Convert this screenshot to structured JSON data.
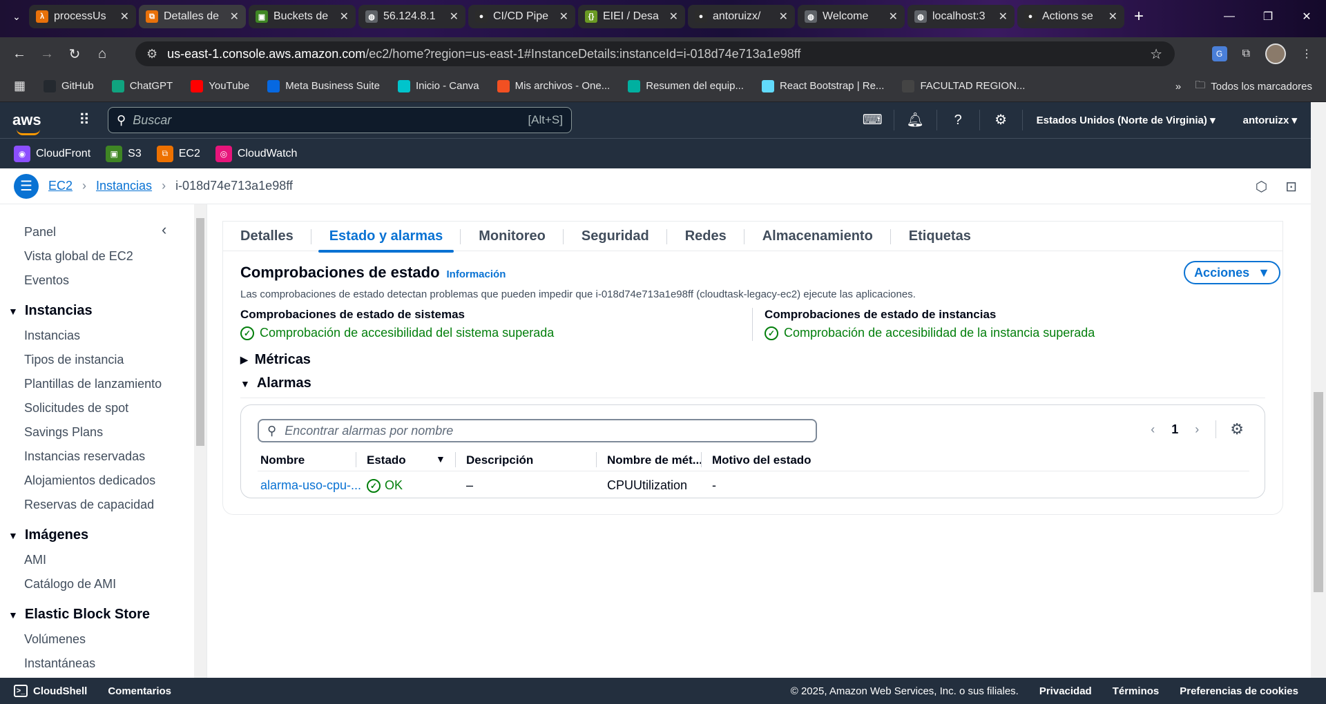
{
  "browser": {
    "tabs": [
      {
        "label": "processUs",
        "color": "#e8710a",
        "glyph": "λ"
      },
      {
        "label": "Detalles de",
        "color": "#e8710a",
        "glyph": "⧉"
      },
      {
        "label": "Buckets de",
        "color": "#3f8624",
        "glyph": "▣"
      },
      {
        "label": "56.124.8.1",
        "color": "#5f6368",
        "glyph": "◍"
      },
      {
        "label": "CI/CD Pipe",
        "color": "#2b2b2b",
        "glyph": "●"
      },
      {
        "label": "EIEI / Desa",
        "color": "#6a9a23",
        "glyph": "{}"
      },
      {
        "label": "antoruizx/",
        "color": "#2b2b2b",
        "glyph": "●"
      },
      {
        "label": "Welcome",
        "color": "#5f6368",
        "glyph": "◍"
      },
      {
        "label": "localhost:3",
        "color": "#5f6368",
        "glyph": "◍"
      },
      {
        "label": "Actions se",
        "color": "#2b2b2b",
        "glyph": "●"
      }
    ],
    "url_host": "us-east-1.console.aws.amazon.com",
    "url_path": "/ec2/home?region=us-east-1#InstanceDetails:instanceId=i-018d74e713a1e98ff",
    "bookmarks": [
      {
        "label": "GitHub",
        "color": "#24292f"
      },
      {
        "label": "ChatGPT",
        "color": "#10a37f"
      },
      {
        "label": "YouTube",
        "color": "#ff0000"
      },
      {
        "label": "Meta Business Suite",
        "color": "#0668e1"
      },
      {
        "label": "Inicio - Canva",
        "color": "#00c4cc"
      },
      {
        "label": "Mis archivos - One...",
        "color": "#f25022"
      },
      {
        "label": "Resumen del equip...",
        "color": "#00b0a0"
      },
      {
        "label": "React Bootstrap | Re...",
        "color": "#61dafb"
      },
      {
        "label": "FACULTAD REGION...",
        "color": "#444444"
      }
    ],
    "all_bookmarks": "Todos los marcadores"
  },
  "aws": {
    "logo": "aws",
    "search_placeholder": "Buscar",
    "search_shortcut": "[Alt+S]",
    "region": "Estados Unidos (Norte de Virginia)",
    "user": "antoruizx",
    "services": [
      {
        "label": "CloudFront",
        "color": "#8c4fff"
      },
      {
        "label": "S3",
        "color": "#3f8624"
      },
      {
        "label": "EC2",
        "color": "#ed7100"
      },
      {
        "label": "CloudWatch",
        "color": "#e7157b"
      }
    ]
  },
  "breadcrumb": {
    "ec2": "EC2",
    "instancias": "Instancias",
    "current": "i-018d74e713a1e98ff"
  },
  "sidebar": {
    "top_items": [
      "Panel",
      "Vista global de EC2",
      "Eventos"
    ],
    "sections": [
      {
        "title": "Instancias",
        "items": [
          "Instancias",
          "Tipos de instancia",
          "Plantillas de lanzamiento",
          "Solicitudes de spot",
          "Savings Plans",
          "Instancias reservadas",
          "Alojamientos dedicados",
          "Reservas de capacidad"
        ]
      },
      {
        "title": "Imágenes",
        "items": [
          "AMI",
          "Catálogo de AMI"
        ]
      },
      {
        "title": "Elastic Block Store",
        "items": [
          "Volúmenes",
          "Instantáneas"
        ]
      }
    ]
  },
  "tabs": [
    "Detalles",
    "Estado y alarmas",
    "Monitoreo",
    "Seguridad",
    "Redes",
    "Almacenamiento",
    "Etiquetas"
  ],
  "active_tab": "Estado y alarmas",
  "status_checks": {
    "title": "Comprobaciones de estado",
    "info": "Información",
    "actions": "Acciones",
    "description": "Las comprobaciones de estado detectan problemas que pueden impedir que i-018d74e713a1e98ff (cloudtask-legacy-ec2) ejecute las aplicaciones.",
    "system_title": "Comprobaciones de estado de sistemas",
    "system_result": "Comprobación de accesibilidad del sistema superada",
    "instance_title": "Comprobaciones de estado de instancias",
    "instance_result": "Comprobación de accesibilidad de la instancia superada"
  },
  "metrics_label": "Métricas",
  "alarms": {
    "label": "Alarmas",
    "search_placeholder": "Encontrar alarmas por nombre",
    "page": "1",
    "columns": [
      "Nombre",
      "Estado",
      "Descripción",
      "Nombre de mét...",
      "Motivo del estado"
    ],
    "rows": [
      {
        "name": "alarma-uso-cpu-...",
        "state": "OK",
        "description": "–",
        "metric": "CPUUtilization",
        "reason": "-"
      }
    ]
  },
  "footer": {
    "cloudshell": "CloudShell",
    "feedback": "Comentarios",
    "copyright": "© 2025, Amazon Web Services, Inc. o sus filiales.",
    "privacy": "Privacidad",
    "terms": "Términos",
    "cookies": "Preferencias de cookies"
  },
  "colors": {
    "accent": "#0972d3",
    "success": "#037f0c",
    "header": "#232f3e"
  }
}
